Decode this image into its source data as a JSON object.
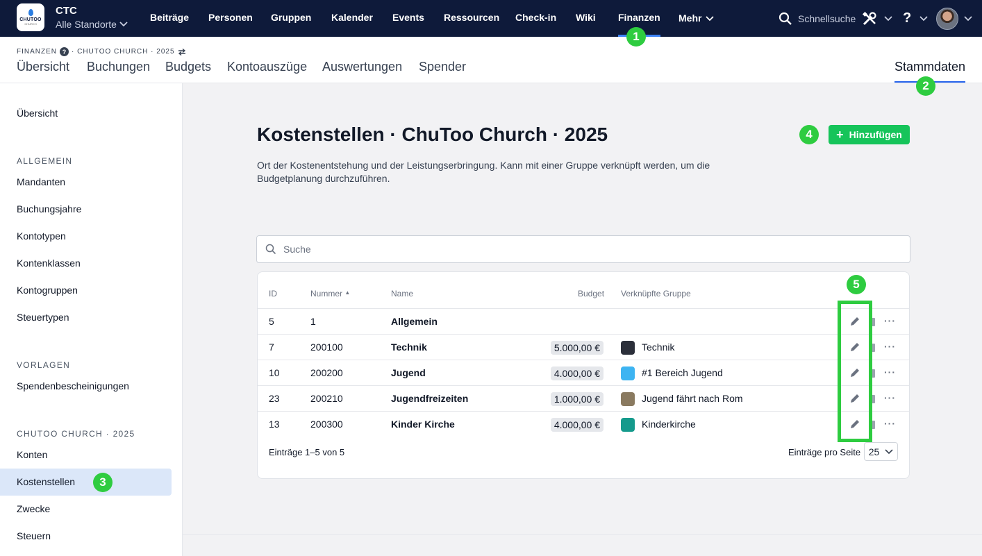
{
  "topbar": {
    "org_name": "CTC",
    "location": "Alle Standorte",
    "logo_text": "CHUTOO",
    "logo_sub": "CHURCH",
    "nav": [
      "Beiträge",
      "Personen",
      "Gruppen",
      "Kalender",
      "Events",
      "Ressourcen",
      "Check-in",
      "Wiki",
      "Finanzen"
    ],
    "active_nav": "Finanzen",
    "more_label": "Mehr",
    "quick_search": "Schnellsuche",
    "help": "?"
  },
  "subheader": {
    "breadcrumb_section": "FINANZEN",
    "breadcrumb_context": "· CHUTOO CHURCH · 2025",
    "tabs": [
      "Übersicht",
      "Buchungen",
      "Budgets",
      "Kontoauszüge",
      "Auswertungen",
      "Spender"
    ],
    "right_tab": "Stammdaten"
  },
  "sidebar": {
    "overview": "Übersicht",
    "section_general": "ALLGEMEIN",
    "general_items": [
      "Mandanten",
      "Buchungsjahre",
      "Kontotypen",
      "Kontenklassen",
      "Kontogruppen",
      "Steuertypen"
    ],
    "section_templates": "VORLAGEN",
    "template_items": [
      "Spendenbescheinigungen"
    ],
    "section_year": "CHUTOO CHURCH · 2025",
    "year_items": [
      "Konten",
      "Kostenstellen",
      "Zwecke",
      "Steuern"
    ],
    "active_item": "Kostenstellen"
  },
  "main": {
    "title": "Kostenstellen · ChuToo Church · 2025",
    "title_menu": "···",
    "description": "Ort der Kostenentstehung und der Leistungserbringung. Kann mit einer Gruppe verknüpft werden, um die Budgetplanung durchzuführen.",
    "add_label": "Hinzufügen",
    "search_placeholder": "Suche"
  },
  "table": {
    "columns": {
      "id": "ID",
      "number": "Nummer",
      "name": "Name",
      "budget": "Budget",
      "group": "Verknüpfte Gruppe"
    },
    "rows": [
      {
        "id": "5",
        "number": "1",
        "name": "Allgemein",
        "budget": "",
        "group": "",
        "group_color": ""
      },
      {
        "id": "7",
        "number": "200100",
        "name": "Technik",
        "budget": "5.000,00 €",
        "group": "Technik",
        "group_color": "#2b2f3a"
      },
      {
        "id": "10",
        "number": "200200",
        "name": "Jugend",
        "budget": "4.000,00 €",
        "group": "#1 Bereich Jugend",
        "group_color": "#3db4f2"
      },
      {
        "id": "23",
        "number": "200210",
        "name": "Jugendfreizeiten",
        "budget": "1.000,00 €",
        "group": "Jugend fährt nach Rom",
        "group_color": "#8a7a60"
      },
      {
        "id": "13",
        "number": "200300",
        "name": "Kinder Kirche",
        "budget": "4.000,00 €",
        "group": "Kinderkirche",
        "group_color": "#159a8c"
      }
    ],
    "footer_entries": "Einträge 1–5 von 5",
    "per_page_label": "Einträge pro Seite",
    "per_page_value": "25"
  },
  "annotations": {
    "m1": "1",
    "m2": "2",
    "m3": "3",
    "m4": "4",
    "m5": "5"
  },
  "colors": {
    "topbar": "#0e1a3a",
    "accent": "#2563eb",
    "add_button": "#16c45a",
    "marker": "#2ecc40"
  }
}
